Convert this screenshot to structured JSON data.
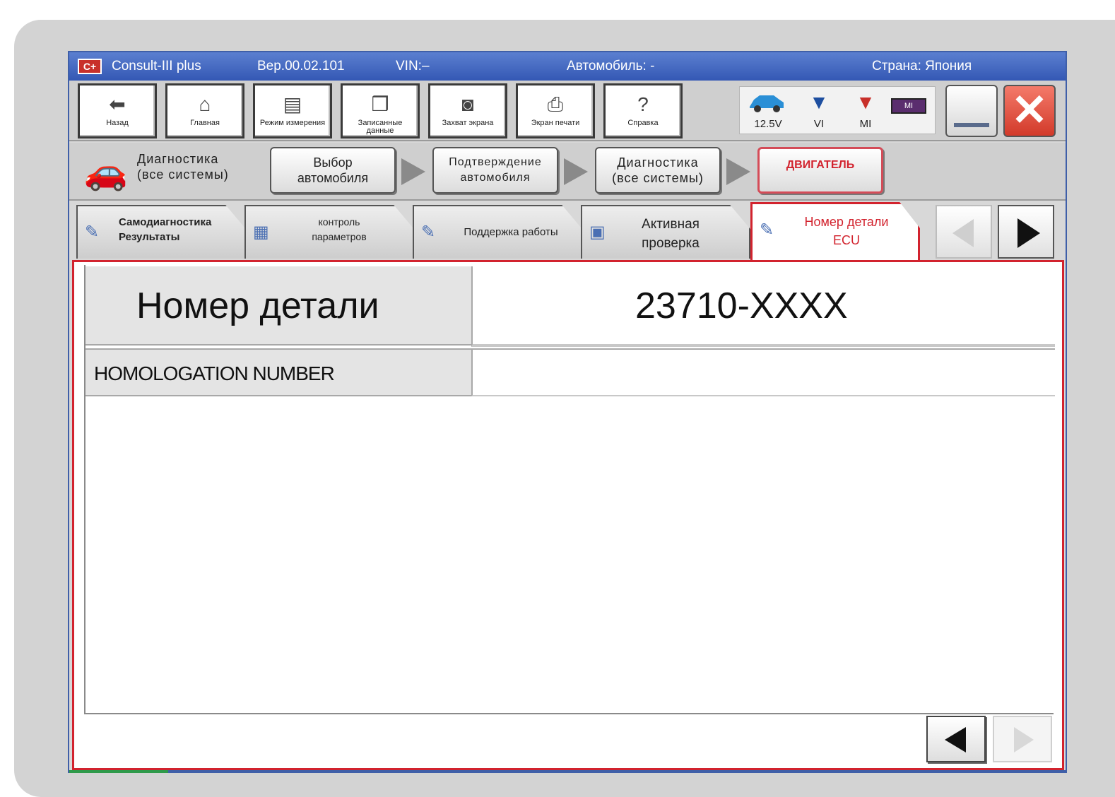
{
  "title_bar": {
    "logo": "C+",
    "app_name": "Consult-III plus",
    "version": "Вер.00.02.101",
    "vin": "VIN:–",
    "vehicle": "Автомобиль: -",
    "country": "Страна: Япония"
  },
  "toolbar": {
    "buttons": [
      {
        "label": "Назад",
        "icon": "back-arrow-icon"
      },
      {
        "label": "Главная",
        "icon": "home-icon"
      },
      {
        "label": "Режим измерения",
        "icon": "measurement-mode-icon"
      },
      {
        "label": "Записанные данные",
        "icon": "recorded-data-icon"
      },
      {
        "label": "Захват экрана",
        "icon": "camera-icon"
      },
      {
        "label": "Экран печати",
        "icon": "printer-icon"
      },
      {
        "label": "Справка",
        "icon": "help-icon"
      }
    ],
    "status": {
      "voltage": "12.5V",
      "vi": "VI",
      "mi": "MI",
      "battery_label": "MI"
    }
  },
  "breadcrumb": {
    "title_line1": "Диагностика",
    "title_line2": "(все системы)",
    "steps": [
      {
        "line1": "Выбор",
        "line2": "автомобиля"
      },
      {
        "line1": "Подтверждение",
        "line2": "автомобиля"
      },
      {
        "line1": "Диагностика",
        "line2": "(все системы)"
      },
      {
        "line1": "ДВИГАТЕЛЬ",
        "line2": ""
      }
    ]
  },
  "tabs": [
    {
      "line1": "Самодиагностика",
      "line2": "Результаты"
    },
    {
      "line1": "контроль",
      "line2": "параметров"
    },
    {
      "line1": "Поддержка работы",
      "line2": ""
    },
    {
      "line1": "Активная",
      "line2": "проверка"
    },
    {
      "line1": "Номер детали",
      "line2": "ECU"
    }
  ],
  "content": {
    "part_number_label": "Номер детали",
    "part_number_value": "23710-XXXX",
    "homologation_label": "HOMOLOGATION NUMBER",
    "homologation_value": ""
  },
  "colors": {
    "title_blue": "#3458b4",
    "accent_red": "#d2232e",
    "panel_gray": "#d3d3d3"
  }
}
